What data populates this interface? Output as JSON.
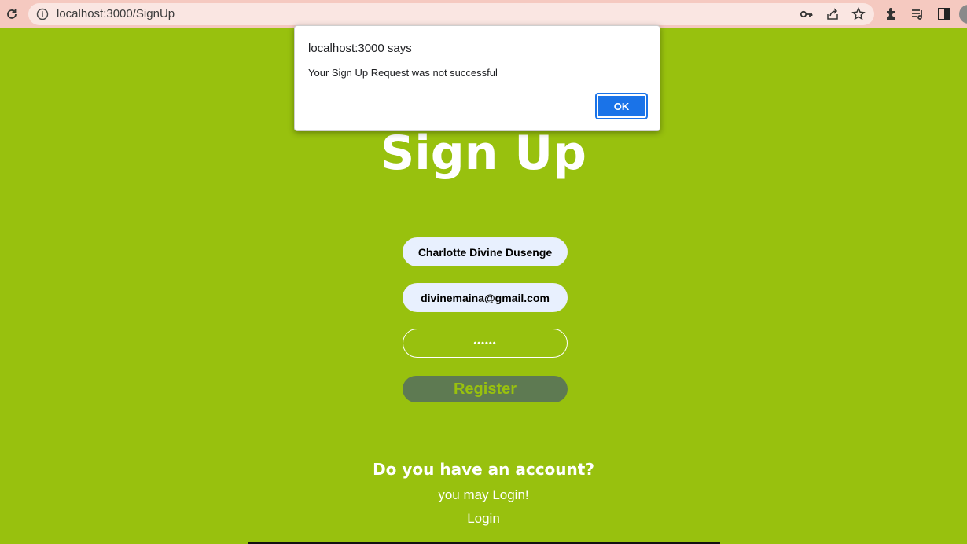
{
  "browser": {
    "url_host": "localhost:3000",
    "url_path": "/SignUp"
  },
  "page": {
    "title": "Sign Up",
    "fields": {
      "name_value": "Charlotte Divine Dusenge",
      "email_value": "divinemaina@gmail.com",
      "password_value": "••••••"
    },
    "register_label": "Register",
    "account_question": "Do you have an account?",
    "login_prompt": "you may Login!",
    "login_link": "Login"
  },
  "dialog": {
    "title": "localhost:3000 says",
    "message": "Your Sign Up Request was not successful",
    "ok_label": "OK"
  },
  "colors": {
    "page_background": "#98c10e",
    "toolbar_background": "#f5c9c0",
    "register_button": "#5e7a52",
    "dialog_ok": "#1a73e8"
  },
  "icons": [
    "reload-icon",
    "info-icon",
    "key-icon",
    "share-icon",
    "star-icon",
    "extensions-icon",
    "reading-list-icon",
    "side-panel-icon"
  ]
}
